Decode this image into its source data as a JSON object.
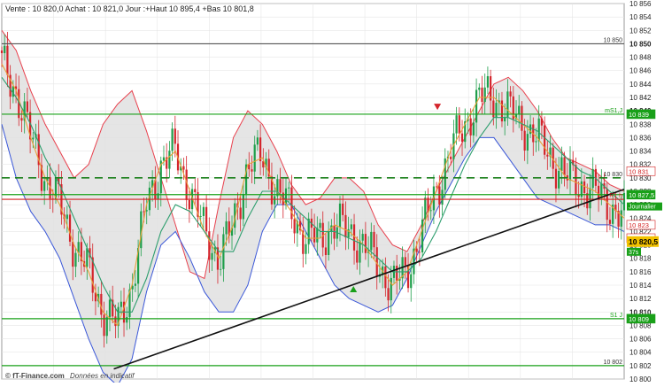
{
  "header": {
    "quote_line": "Vente : 10 820,0 Achat : 10 821,0 Jour :+Haut 10 895,4 +Bas 10 801,8"
  },
  "footer": {
    "brand": "© fT-Finance.com",
    "note": "Données en indicatif"
  },
  "colors": {
    "background": "#ffffff",
    "grid": "#e6e6e6",
    "bollinger_fill": "#e0e0e0",
    "bollinger_upper": "#e8404d",
    "bollinger_lower": "#3a57d8",
    "ema_short": "#e8a13a",
    "ema_long": "#2e9e6e",
    "candle_up": "#1e9e4a",
    "candle_down": "#d4252c",
    "support": "#19a019",
    "resistance": "#d42020",
    "trendline": "#111111",
    "pivot_dashed": "#1a7f1a",
    "price_tag": "#f2c200"
  },
  "chart_data": {
    "type": "candlestick",
    "instrument_period": "Journalier",
    "ylim": [
      10800,
      10856
    ],
    "y_ticks": [
      "10 856",
      "10 854",
      "10 852",
      "10 850",
      "10 848",
      "10 846",
      "10 844",
      "10 842",
      "10 840",
      "10 838",
      "10 836",
      "10 834",
      "10 832",
      "10 830",
      "10 828",
      "10 826",
      "10 824",
      "10 822",
      "10 820",
      "10 818",
      "10 816",
      "10 814",
      "10 812",
      "10 810",
      "10 808",
      "10 806",
      "10 804",
      "10 802",
      "10 800"
    ],
    "last_price": "10 820,5",
    "last_label": "37s",
    "grid": true,
    "levels": [
      {
        "name": "10 850",
        "value": 10850,
        "style": "solid",
        "color": "#555555"
      },
      {
        "name": "mS1",
        "value": 10839.5,
        "style": "solid",
        "color": "#19a019",
        "tag": "10 839"
      },
      {
        "name": "10 830",
        "value": 10830,
        "style": "dashed",
        "color": "#1a7f1a"
      },
      {
        "name": "10 831",
        "value": 10831,
        "style": "none",
        "color": "#d42020",
        "tag": "10 831"
      },
      {
        "name": "R1",
        "value": 10827.5,
        "style": "solid",
        "color": "#19a019",
        "tag": "10 827,5"
      },
      {
        "name": "R1-h",
        "value": 10826.8,
        "style": "solid",
        "color": "#d42020"
      },
      {
        "name": "10 823",
        "value": 10823,
        "style": "none",
        "color": "#d42020",
        "tag": "10 823"
      },
      {
        "name": "10 821",
        "value": 10821,
        "style": "none",
        "color": "#d42020",
        "tag": "10 821"
      },
      {
        "name": "S1",
        "value": 10809,
        "style": "solid",
        "color": "#19a019",
        "tag": "10 809"
      },
      {
        "name": "10 802",
        "value": 10802,
        "style": "solid",
        "color": "#19a019"
      }
    ],
    "right_labels": [
      "10 850",
      "mS1,J",
      "10 830",
      "R1 h",
      "S1 J",
      "10 802",
      "Journalier"
    ],
    "trendline": [
      [
        0.18,
        10801.5
      ],
      [
        1.0,
        10828.3
      ]
    ],
    "bollinger_upper": [
      10852,
      10849,
      10843,
      10838,
      10834,
      10830,
      10832,
      10838,
      10841,
      10843,
      10837,
      10830,
      10823,
      10816,
      10815,
      10826,
      10836,
      10840,
      10838,
      10834,
      10829,
      10826,
      10827,
      10830,
      10830,
      10828,
      10823,
      10820,
      10819,
      10823,
      10828,
      10832,
      10836,
      10840,
      10844,
      10845,
      10843,
      10840,
      10836,
      10833,
      10832,
      10831,
      10829,
      10828
    ],
    "bollinger_lower": [
      10838,
      10830,
      10825,
      10822,
      10818,
      10812,
      10806,
      10801,
      10799,
      10803,
      10813,
      10820,
      10822,
      10818,
      10813,
      10810,
      10810,
      10814,
      10822,
      10826,
      10826,
      10822,
      10818,
      10814,
      10812,
      10811,
      10810,
      10811,
      10815,
      10820,
      10825,
      10829,
      10833,
      10836,
      10836,
      10833,
      10830,
      10827,
      10826,
      10825,
      10824,
      10823,
      10823,
      10822
    ],
    "ema_short": [
      10847,
      10843,
      10836,
      10830,
      10826,
      10820,
      10816,
      10810,
      10808,
      10814,
      10826,
      10832,
      10834,
      10828,
      10822,
      10818,
      10823,
      10832,
      10833,
      10828,
      10825,
      10821,
      10821,
      10823,
      10822,
      10820,
      10817,
      10814,
      10816,
      10822,
      10828,
      10834,
      10838,
      10842,
      10842,
      10840,
      10838,
      10836,
      10833,
      10830,
      10829,
      10828,
      10826,
      10824
    ],
    "ema_long": [
      10845,
      10842,
      10838,
      10833,
      10829,
      10824,
      10819,
      10814,
      10810,
      10810,
      10815,
      10822,
      10826,
      10825,
      10822,
      10819,
      10819,
      10824,
      10828,
      10828,
      10826,
      10824,
      10822,
      10822,
      10821,
      10820,
      10818,
      10816,
      10816,
      10818,
      10822,
      10827,
      10832,
      10836,
      10839,
      10839,
      10838,
      10837,
      10835,
      10833,
      10831,
      10830,
      10828,
      10826
    ]
  }
}
